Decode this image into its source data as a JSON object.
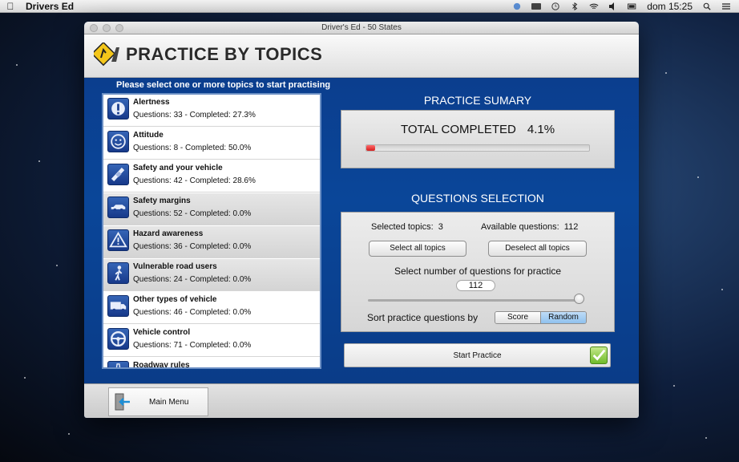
{
  "menubar": {
    "app_name": "Drivers Ed",
    "clock": "dom 15:25"
  },
  "window": {
    "title": "Driver's Ed - 50 States"
  },
  "header": {
    "title": "PRACTICE BY TOPICS"
  },
  "topics": {
    "caption": "Please select one or more topics to start practising",
    "items": [
      {
        "name": "Alertness",
        "stats": "Questions: 33 - Completed: 27.3%",
        "icon": "exclamation-icon",
        "selected": false
      },
      {
        "name": "Attitude",
        "stats": "Questions: 8 - Completed: 50.0%",
        "icon": "smiley-icon",
        "selected": false
      },
      {
        "name": "Safety and your vehicle",
        "stats": "Questions: 42 - Completed: 28.6%",
        "icon": "seatbelt-icon",
        "selected": false
      },
      {
        "name": "Safety margins",
        "stats": "Questions: 52 - Completed: 0.0%",
        "icon": "car-icon",
        "selected": true
      },
      {
        "name": "Hazard awareness",
        "stats": "Questions: 36 - Completed: 0.0%",
        "icon": "warning-triangle-icon",
        "selected": true
      },
      {
        "name": "Vulnerable road users",
        "stats": "Questions: 24 - Completed: 0.0%",
        "icon": "pedestrian-icon",
        "selected": true
      },
      {
        "name": "Other types of vehicle",
        "stats": "Questions: 46 - Completed: 0.0%",
        "icon": "truck-icon",
        "selected": false
      },
      {
        "name": "Vehicle control",
        "stats": "Questions: 71 - Completed: 0.0%",
        "icon": "steering-wheel-icon",
        "selected": false
      },
      {
        "name": "Roadway rules",
        "stats": "",
        "icon": "road-icon",
        "selected": false
      }
    ]
  },
  "summary": {
    "title": "PRACTICE SUMARY",
    "total_label": "TOTAL COMPLETED",
    "total_value": "4.1%",
    "progress_fraction": 0.041
  },
  "selection": {
    "title": "QUESTIONS SELECTION",
    "selected_topics_label": "Selected topics:",
    "selected_topics_value": "3",
    "available_label": "Available questions:",
    "available_value": "112",
    "select_all": "Select all topics",
    "deselect_all": "Deselect all topics",
    "number_label": "Select number of questions for practice",
    "number_value": "112",
    "slider_fraction": 1.0,
    "sort_label": "Sort practice questions by",
    "sort_options": [
      "Score",
      "Random"
    ],
    "sort_selected": "Random"
  },
  "start_button": "Start Practice",
  "footer": {
    "main_menu": "Main Menu"
  },
  "colors": {
    "content_blue": "#0a4699",
    "progress_red": "#d41e1e",
    "segment_active": "#8fc1ee",
    "check_green": "#6fbb2a"
  }
}
